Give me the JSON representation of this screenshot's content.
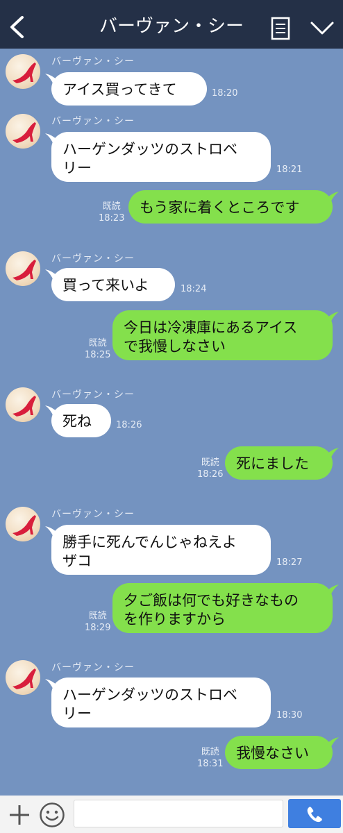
{
  "header": {
    "title": "バーヴァン・シー"
  },
  "messages": [
    {
      "side": "in",
      "sender": "バーヴァン・シー",
      "text": "アイス買ってきて",
      "time": "18:20"
    },
    {
      "side": "in",
      "sender": "バーヴァン・シー",
      "line1": "ハーゲンダッツのストロベ",
      "line2": "リー",
      "time": "18:21"
    },
    {
      "side": "out",
      "read": "既読",
      "text": "もう家に着くところです",
      "time": "18:23"
    },
    {
      "side": "in",
      "sender": "バーヴァン・シー",
      "text": "買って来いよ",
      "time": "18:24"
    },
    {
      "side": "out",
      "read": "既読",
      "line1": "今日は冷凍庫にあるアイス",
      "line2": "で我慢しなさい",
      "time": "18:25"
    },
    {
      "side": "in",
      "sender": "バーヴァン・シー",
      "text": "死ね",
      "time": "18:26"
    },
    {
      "side": "out",
      "read": "既読",
      "text": "死にました",
      "time": "18:26"
    },
    {
      "side": "in",
      "sender": "バーヴァン・シー",
      "line1": "勝手に死んでんじゃねえよ",
      "line2": "ザコ",
      "time": "18:27"
    },
    {
      "side": "out",
      "read": "既読",
      "line1": "夕ご飯は何でも好きなもの",
      "line2": "を作りますから",
      "time": "18:29"
    },
    {
      "side": "in",
      "sender": "バーヴァン・シー",
      "line1": "ハーゲンダッツのストロベ",
      "line2": "リー",
      "time": "18:30"
    },
    {
      "side": "out",
      "read": "既読",
      "text": "我慢なさい",
      "time": "18:31"
    }
  ],
  "icons": {
    "back": "chevron-left-icon",
    "memo": "note-icon",
    "menu": "chevron-down-icon",
    "add": "plus-icon",
    "emoji": "smiley-icon",
    "call": "phone-icon"
  },
  "colors": {
    "background": "#7493c0",
    "header": "#243047",
    "incoming_bubble": "#ffffff",
    "outgoing_bubble": "#84e04c",
    "call_button": "#3f7fe0"
  }
}
